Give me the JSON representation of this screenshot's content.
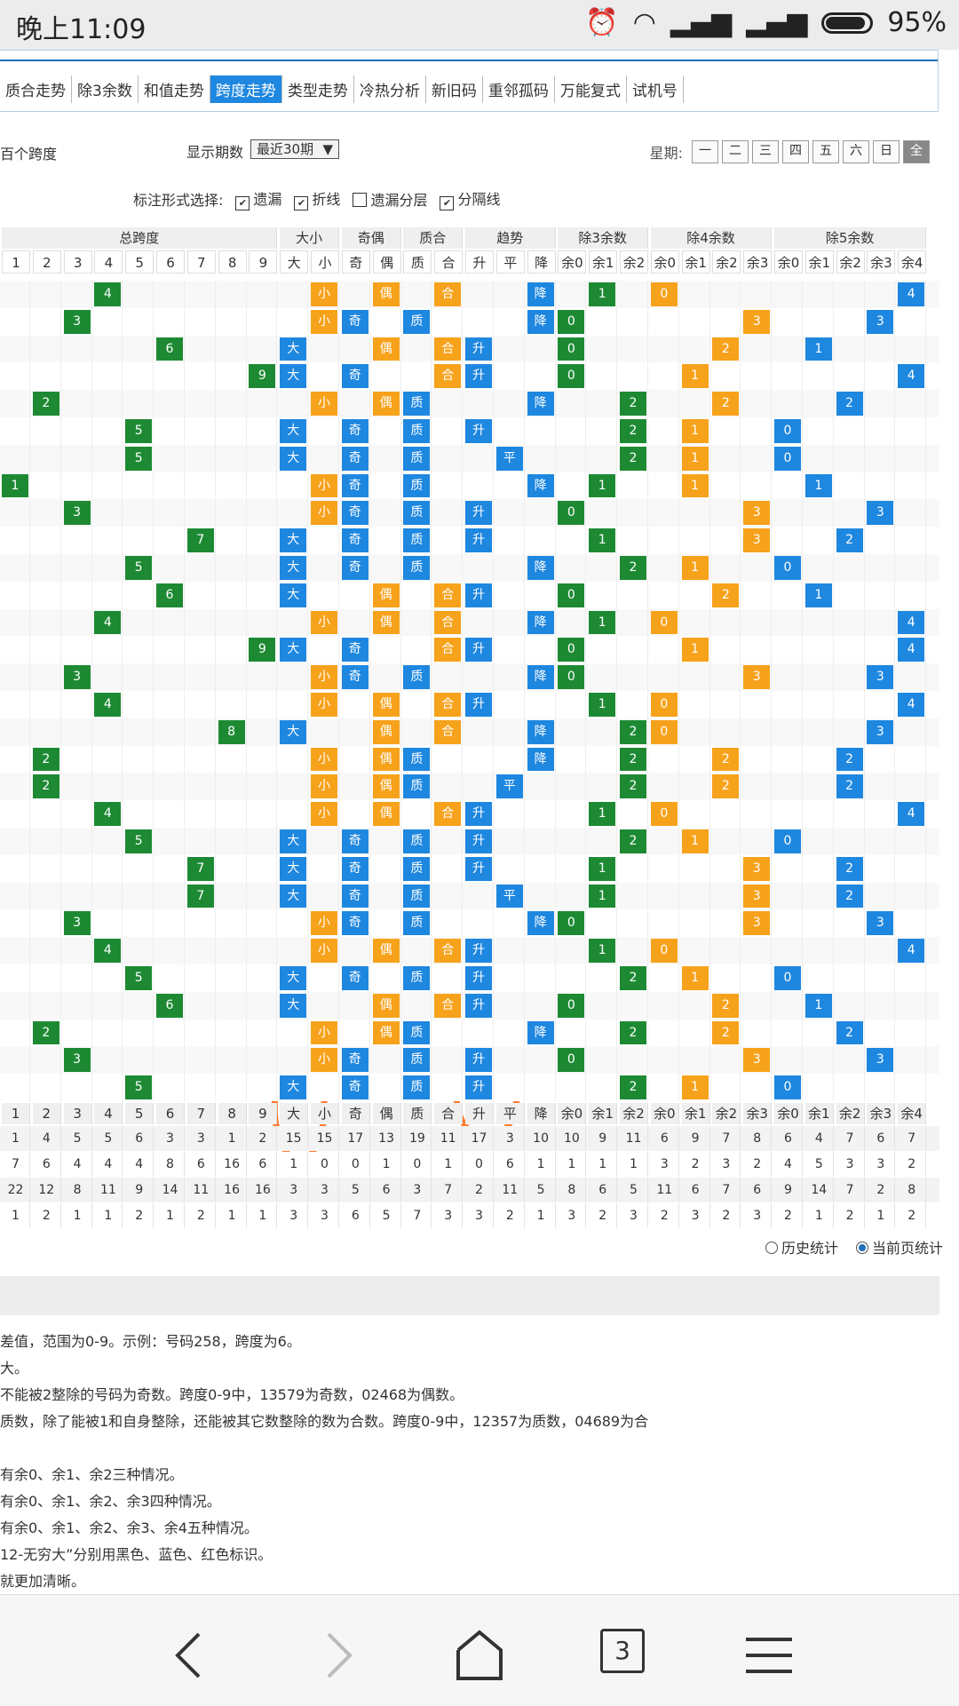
{
  "status": {
    "time": "晚上11:09",
    "battery": "95%"
  },
  "nav": {
    "tabs": [
      "质合走势",
      "除3余数",
      "和值走势",
      "跨度走势",
      "类型走势",
      "冷热分析",
      "新旧码",
      "重邻孤码",
      "万能复式",
      "试机号"
    ],
    "active": 3
  },
  "controls": {
    "title": "百个跨度",
    "period_label": "显示期数",
    "period_value": "最近30期",
    "week_label": "星期:",
    "weekdays": [
      "一",
      "二",
      "三",
      "四",
      "五",
      "六",
      "日",
      "全"
    ],
    "week_selected": 7
  },
  "options": {
    "label": "标注形式选择:",
    "items": [
      {
        "label": "遗漏",
        "checked": true
      },
      {
        "label": "折线",
        "checked": true
      },
      {
        "label": "遗漏分层",
        "checked": false
      },
      {
        "label": "分隔线",
        "checked": true
      }
    ]
  },
  "groups": [
    "总跨度",
    "大小",
    "奇偶",
    "质合",
    "趋势",
    "除3余数",
    "除4余数",
    "除5余数"
  ],
  "colheads": [
    "1",
    "2",
    "3",
    "4",
    "5",
    "6",
    "7",
    "8",
    "9",
    "大",
    "小",
    "奇",
    "偶",
    "质",
    "合",
    "升",
    "平",
    "降",
    "余0",
    "余1",
    "余2",
    "余0",
    "余1",
    "余2",
    "余3",
    "余0",
    "余1",
    "余2",
    "余3",
    "余4"
  ],
  "rows": [
    [
      4,
      "小",
      "偶",
      "合",
      "降",
      1,
      0,
      4
    ],
    [
      3,
      "小",
      "奇",
      "质",
      "降",
      0,
      3,
      3
    ],
    [
      6,
      "大",
      "偶",
      "合",
      "升",
      0,
      2,
      1
    ],
    [
      9,
      "大",
      "奇",
      "合",
      "升",
      0,
      1,
      4
    ],
    [
      2,
      "小",
      "偶",
      "质",
      "降",
      2,
      2,
      2
    ],
    [
      5,
      "大",
      "奇",
      "质",
      "升",
      2,
      1,
      0
    ],
    [
      5,
      "大",
      "奇",
      "质",
      "平",
      2,
      1,
      0
    ],
    [
      1,
      "小",
      "奇",
      "质",
      "降",
      1,
      1,
      1
    ],
    [
      3,
      "小",
      "奇",
      "质",
      "升",
      0,
      3,
      3
    ],
    [
      7,
      "大",
      "奇",
      "质",
      "升",
      1,
      3,
      2
    ],
    [
      5,
      "大",
      "奇",
      "质",
      "降",
      2,
      1,
      0
    ],
    [
      6,
      "大",
      "偶",
      "合",
      "升",
      0,
      2,
      1
    ],
    [
      4,
      "小",
      "偶",
      "合",
      "降",
      1,
      0,
      4
    ],
    [
      9,
      "大",
      "奇",
      "合",
      "升",
      0,
      1,
      4
    ],
    [
      3,
      "小",
      "奇",
      "质",
      "降",
      0,
      3,
      3
    ],
    [
      4,
      "小",
      "偶",
      "合",
      "升",
      1,
      0,
      4
    ],
    [
      8,
      "大",
      "偶",
      "合",
      "降",
      2,
      0,
      3
    ],
    [
      2,
      "小",
      "偶",
      "质",
      "降",
      2,
      2,
      2
    ],
    [
      2,
      "小",
      "偶",
      "质",
      "平",
      2,
      2,
      2
    ],
    [
      4,
      "小",
      "偶",
      "合",
      "升",
      1,
      0,
      4
    ],
    [
      5,
      "大",
      "奇",
      "质",
      "升",
      2,
      1,
      0
    ],
    [
      7,
      "大",
      "奇",
      "质",
      "升",
      1,
      3,
      2
    ],
    [
      7,
      "大",
      "奇",
      "质",
      "平",
      1,
      3,
      2
    ],
    [
      3,
      "小",
      "奇",
      "质",
      "降",
      0,
      3,
      3
    ],
    [
      4,
      "小",
      "偶",
      "合",
      "升",
      1,
      0,
      4
    ],
    [
      5,
      "大",
      "奇",
      "质",
      "升",
      2,
      1,
      0
    ],
    [
      6,
      "大",
      "偶",
      "合",
      "升",
      0,
      2,
      1
    ],
    [
      2,
      "小",
      "偶",
      "质",
      "降",
      2,
      2,
      2
    ],
    [
      3,
      "小",
      "奇",
      "质",
      "升",
      0,
      3,
      3
    ],
    [
      5,
      "大",
      "奇",
      "质",
      "升",
      2,
      1,
      0
    ]
  ],
  "summary_rows": [
    [
      "1",
      "4",
      "5",
      "5",
      "6",
      "3",
      "3",
      "1",
      "2",
      "15",
      "15",
      "17",
      "13",
      "19",
      "11",
      "17",
      "3",
      "10",
      "10",
      "9",
      "11",
      "6",
      "9",
      "7",
      "8",
      "6",
      "4",
      "7",
      "6",
      "7"
    ],
    [
      "7",
      "6",
      "4",
      "4",
      "4",
      "8",
      "6",
      "16",
      "6",
      "1",
      "0",
      "0",
      "1",
      "0",
      "1",
      "0",
      "6",
      "1",
      "1",
      "1",
      "1",
      "3",
      "2",
      "3",
      "2",
      "4",
      "5",
      "3",
      "3",
      "2"
    ],
    [
      "22",
      "12",
      "8",
      "11",
      "9",
      "14",
      "11",
      "16",
      "16",
      "3",
      "3",
      "5",
      "6",
      "3",
      "7",
      "2",
      "11",
      "5",
      "8",
      "6",
      "5",
      "11",
      "6",
      "7",
      "6",
      "9",
      "14",
      "7",
      "2",
      "8"
    ],
    [
      "1",
      "2",
      "1",
      "1",
      "2",
      "1",
      "2",
      "1",
      "1",
      "3",
      "3",
      "6",
      "5",
      "7",
      "3",
      "3",
      "2",
      "1",
      "3",
      "2",
      "3",
      "2",
      "3",
      "2",
      "3",
      "2",
      "1",
      "2",
      "1",
      "2"
    ]
  ],
  "radios": {
    "items": [
      "历史统计",
      "当前页统计"
    ],
    "selected": 1
  },
  "notes": [
    "差值，范围为0-9。示例：号码258，跨度为6。",
    "大。",
    "不能被2整除的号码为奇数。跨度0-9中，13579为奇数，02468为偶数。",
    "质数，除了能被1和自身整除，还能被其它数整除的数为合数。跨度0-9中，12357为质数，04689为合",
    "",
    "有余0、余1、余2三种情况。",
    "有余0、余1、余2、余3四种情况。",
    "有余0、余1、余2、余3、余4五种情况。",
    "12-无穷大”分别用黑色、蓝色、红色标识。",
    "就更加清晰。"
  ],
  "bottom": {
    "tab_count": "3"
  },
  "colors": {
    "blue": "#1e87e0",
    "orange": "#f7a21b",
    "green": "#1d8a33",
    "line": "#d99a3a",
    "circle": "#ff7a2e"
  }
}
